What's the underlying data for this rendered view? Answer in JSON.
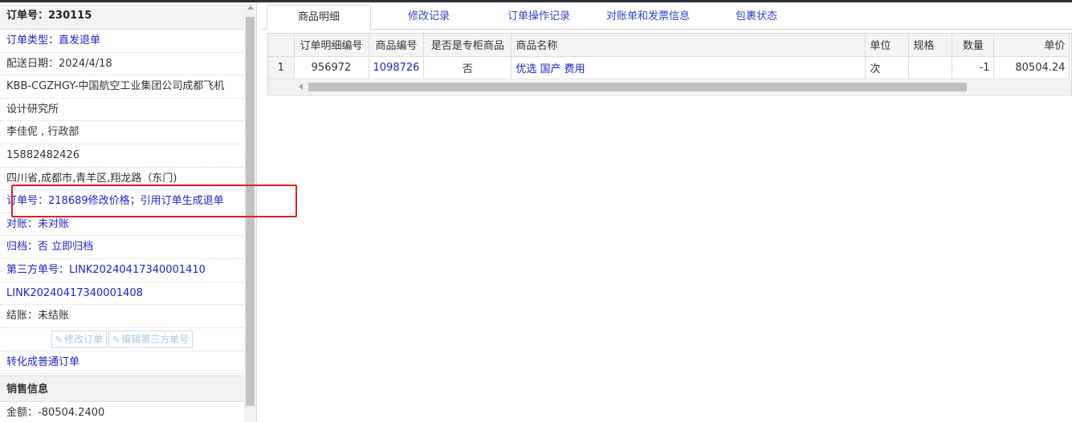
{
  "order_panel": {
    "title": "订单号：230115",
    "order_type": "订单类型：直发退单",
    "delivery_date": "配送日期：2024/4/18",
    "company_line1": "KBB-CGZHGY-中国航空工业集团公司成都飞机",
    "company_line2": "设计研究所",
    "contact": "李佳伲 , 行政部",
    "phone": "15882482426",
    "address": "四川省,成都市,青羊区,翔龙路（东门)",
    "note": "订单号：218689修改价格；引用订单生成退单",
    "reconcile": "对账：未对账",
    "archive_label": "归档：",
    "archive_value": "否 立即归档",
    "third_party_1": "第三方单号：LINK20240417340001410",
    "third_party_2": "LINK20240417340001408",
    "settlement": "结账：未结账",
    "btn_edit_order": "修改订单",
    "btn_edit_third": "编辑第三方单号",
    "convert_link": "转化成普通订单",
    "sales_section": "销售信息",
    "amount": "金额：-80504.2400"
  },
  "tabs": [
    "商品明细",
    "修改记录",
    "订单操作记录",
    "对账单和发票信息",
    "包裹状态"
  ],
  "grid": {
    "columns": [
      "订单明细编号",
      "商品编号",
      "是否是专柜商品",
      "商品名称",
      "单位",
      "规格",
      "数量",
      "单价"
    ],
    "rows": [
      {
        "row_num": "1",
        "detail_id": "956972",
        "product_id": "1098726",
        "is_counter": "否",
        "name": "优选 国产 费用",
        "unit": "次",
        "spec": "",
        "qty": "-1",
        "price": "80504.24"
      }
    ]
  },
  "colors": {
    "link": "#2222cc",
    "highlight": "#e02020"
  }
}
